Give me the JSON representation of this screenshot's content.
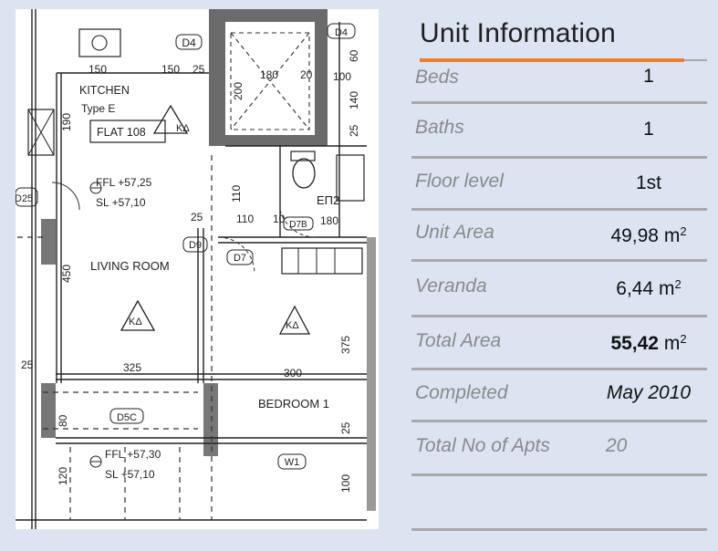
{
  "plan": {
    "labels": {
      "d4": "D4",
      "d4b": "D4",
      "kitchen": "KITCHEN",
      "type": "Type E",
      "flat": "FLAT 108",
      "ka1": "ΚΔ",
      "ka2": "ΚΔ",
      "ka3": "ΚΔ",
      "ffl1": "FFL +57,25",
      "sl1": "SL  +57,10",
      "living": "LIVING ROOM",
      "bedroom": "BEDROOM 1",
      "d9": "D9",
      "d7": "D7",
      "d7b": "D7B",
      "ep2": "ΕΠ2",
      "d5c": "D5C",
      "ffl2": "FFL +57,30",
      "sl2": "SL  +57,10",
      "w1": "W1",
      "d25": "D25"
    },
    "dims": {
      "d150a": "150",
      "d150b": "150",
      "d25a": "25",
      "d180": "180",
      "d20": "20",
      "d100a": "100",
      "d60": "60",
      "d140": "140",
      "d25b": "25",
      "d190": "190",
      "d200": "200",
      "d110a": "110",
      "d110b": "110",
      "d10": "10",
      "d180b": "180",
      "d25c": "25",
      "d450": "450",
      "d325": "325",
      "d300": "300",
      "d375": "375",
      "d25d": "25",
      "d80": "80",
      "d120": "120",
      "d100b": "100",
      "d25e": "25"
    }
  },
  "panel": {
    "title": "Unit Information",
    "rows": [
      {
        "label": "Beds",
        "value": "1"
      },
      {
        "label": "Baths",
        "value": "1"
      },
      {
        "label": "Floor level",
        "value": "1st"
      },
      {
        "label": "Unit Area",
        "value": "49,98 m",
        "unit": "2"
      },
      {
        "label": "Veranda",
        "value": "6,44 m",
        "unit": "2"
      },
      {
        "label": "Total Area",
        "value": "55,42",
        "suffix": " m",
        "unit": "2"
      },
      {
        "label": "Completed",
        "value": "May 2010"
      },
      {
        "label": "Total No of Apts",
        "value": "20"
      }
    ]
  },
  "colors": {
    "background": "#dbe4f0",
    "accent": "#ee7f2d",
    "rule": "#a9a9a9",
    "label": "#8a8a8a"
  }
}
